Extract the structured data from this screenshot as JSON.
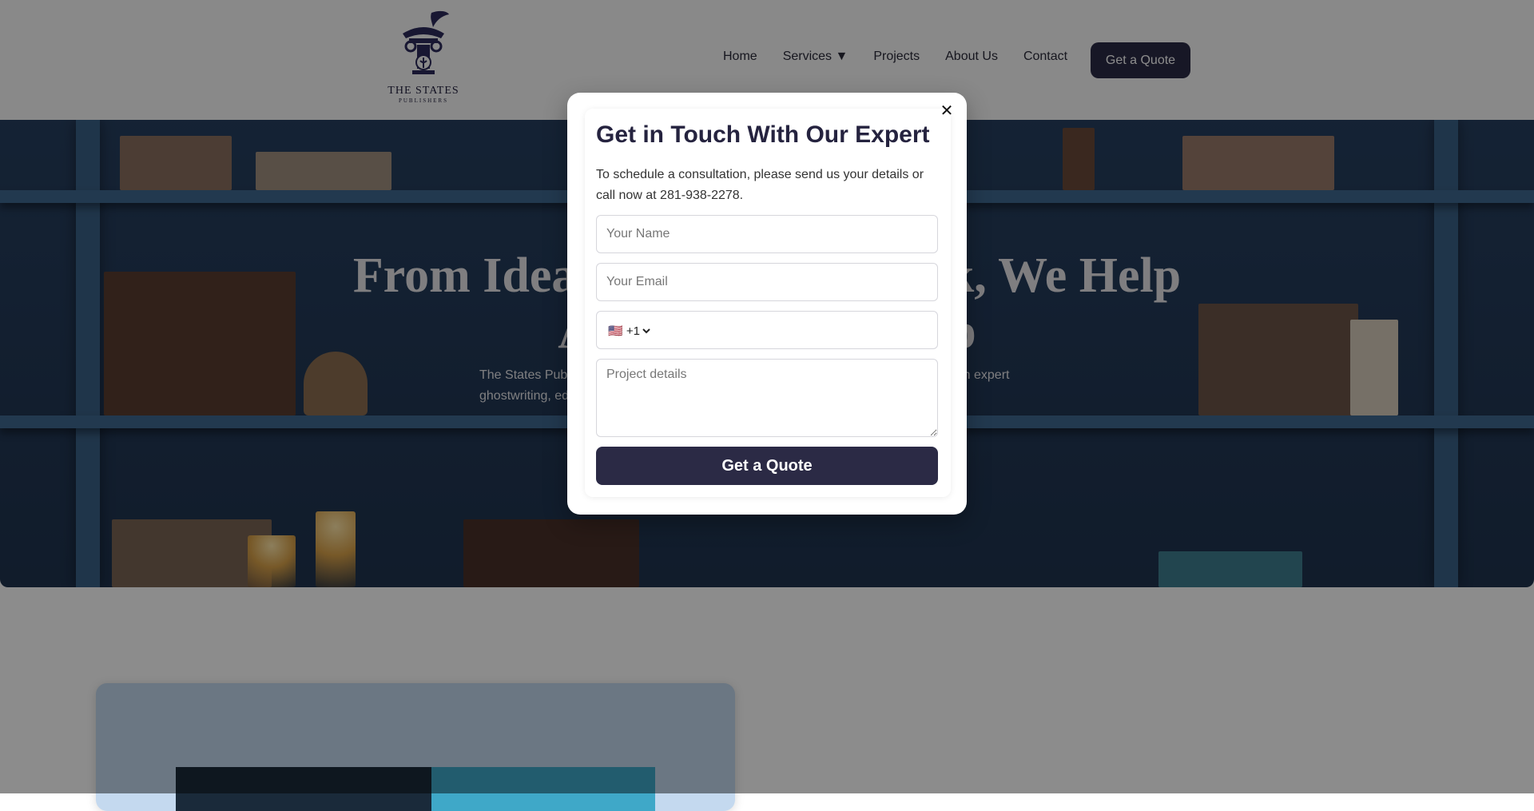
{
  "header": {
    "logo_text": "THE STATES",
    "logo_sub": "PUBLISHERS",
    "nav": [
      {
        "label": "Home"
      },
      {
        "label": "Services ▼"
      },
      {
        "label": "Projects"
      },
      {
        "label": "About Us"
      },
      {
        "label": "Contact"
      }
    ],
    "cta_label": "Get a Quote"
  },
  "hero": {
    "title_line1": "From Idea to Published Book, We Help",
    "title_line2": "Authors Every Step",
    "description": "The States Publishers helps authors bring their stories to life as a published book. With expert ghostwriting, editing, design and marketing services."
  },
  "modal": {
    "title": "Get in Touch With Our Expert",
    "text": "To schedule a consultation, please send us your details or call now at 281-938-2278.",
    "name_placeholder": "Your Name",
    "email_placeholder": "Your Email",
    "phone_code": "🇺🇸 +1",
    "project_placeholder": "Project details",
    "submit_label": "Get a Quote",
    "close_icon": "close-icon"
  },
  "colors": {
    "primary": "#2b2a45",
    "hero_blue": "#2a4466"
  }
}
